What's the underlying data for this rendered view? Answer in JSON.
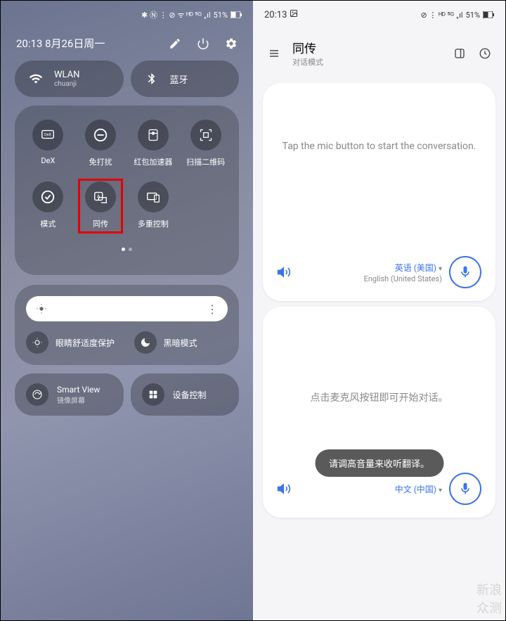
{
  "left": {
    "status": {
      "time": "",
      "icons": "✱ Ⓝ ⋮ ⊘ ᯤ ᴴᴰ ⁵ᴳ ₊ıl",
      "battery": "51%"
    },
    "datetime": "20:13  8月26日周一",
    "wlan": {
      "title": "WLAN",
      "sub": "chuanji"
    },
    "bluetooth": {
      "title": "蓝牙"
    },
    "tiles": {
      "dex": "DeX",
      "dnd": "免打扰",
      "redpacket": "红包加速器",
      "qr": "扫描二维码",
      "mode": "模式",
      "interpret": "同传",
      "multicontrol": "多重控制"
    },
    "eye": "眼睛舒适度保护",
    "dark": "黑暗模式",
    "smartview": {
      "title": "Smart View",
      "sub": "镜像屏幕"
    },
    "devicecontrol": "设备控制"
  },
  "right": {
    "status": {
      "time": "20:13",
      "icons": "⊘ ⋮ ᴴᴰ ⁵ᴳ ₊ıl",
      "battery": "51%"
    },
    "title": "同传",
    "subtitle": "对话模式",
    "panel1": {
      "prompt": "Tap the mic button to start the conversation.",
      "lang": "英语 (美国)",
      "langSub": "English (United States)"
    },
    "panel2": {
      "prompt": "点击麦克风按钮即可开始对话。",
      "lang": "中文 (中国)",
      "toast": "请调高音量来收听翻译。"
    }
  },
  "watermark": "新浪\n众测"
}
